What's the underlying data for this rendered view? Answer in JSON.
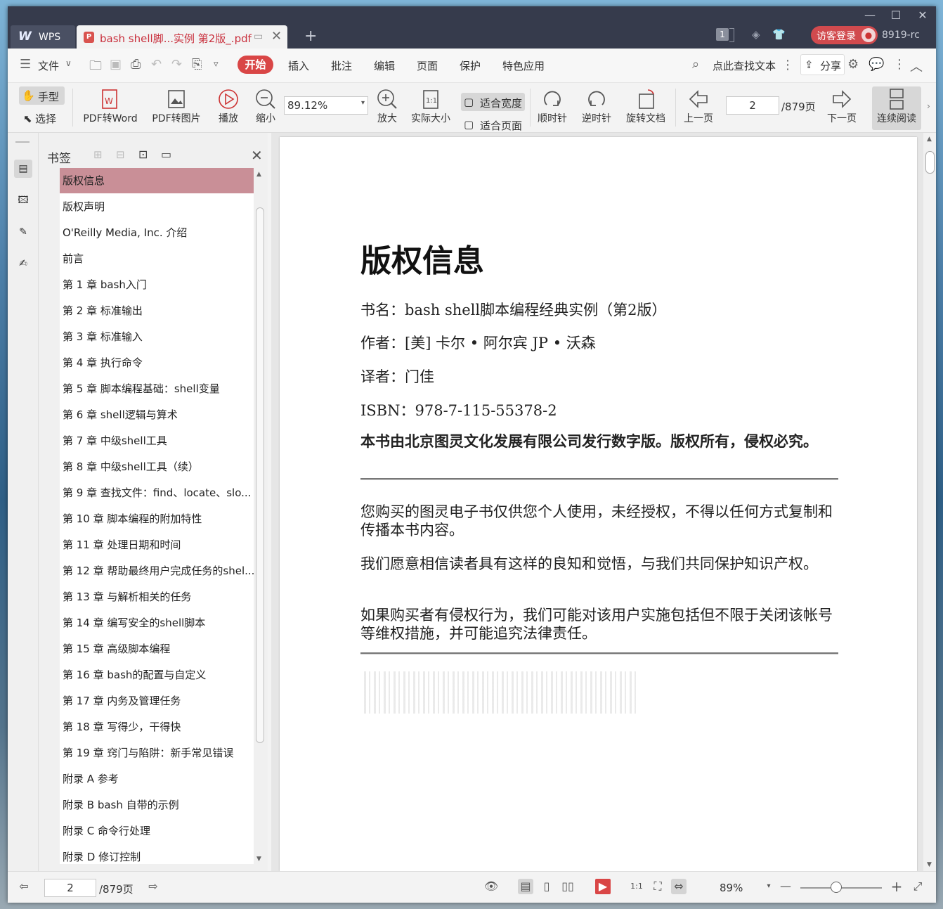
{
  "window": {
    "title_tabs": [
      {
        "label": "WPS"
      },
      {
        "label": "bash shell脚...实例 第2版_.pdf"
      }
    ],
    "version_text": "8919-rc",
    "login_label": "访客登录",
    "page_count_badge": "1"
  },
  "menubar": {
    "file_label": "文件",
    "tabs": [
      "开始",
      "插入",
      "批注",
      "编辑",
      "页面",
      "保护",
      "特色应用"
    ],
    "active_tab": "开始",
    "search_label": "点此查找文本",
    "share_label": "分享"
  },
  "toolbar": {
    "hand_label": "手型",
    "select_label": "选择",
    "pdf_to_word": "PDF转Word",
    "pdf_to_image": "PDF转图片",
    "play": "播放",
    "zoom_out": "缩小",
    "zoom_value": "89.12%",
    "zoom_in": "放大",
    "actual_size": "实际大小",
    "fit_width": "适合宽度",
    "fit_page": "适合页面",
    "rotate_cw": "顺时针",
    "rotate_ccw": "逆时针",
    "rotate_doc": "旋转文档",
    "prev_page": "上一页",
    "page_current": "2",
    "page_total": "/879页",
    "next_page": "下一页",
    "continuous": "连续阅读"
  },
  "bookmarks": {
    "title": "书签",
    "selected_index": 0,
    "items": [
      "版权信息",
      "版权声明",
      "O'Reilly Media, Inc. 介绍",
      "前言",
      "第 1 章 bash入门",
      "第 2 章 标准输出",
      "第 3 章 标准输入",
      "第 4 章 执行命令",
      "第 5 章 脚本编程基础：shell变量",
      "第 6 章 shell逻辑与算术",
      "第 7 章 中级shell工具",
      "第 8 章 中级shell工具（续）",
      "第 9 章 查找文件：find、locate、slo...",
      "第 10 章 脚本编程的附加特性",
      "第 11 章 处理日期和时间",
      "第 12 章 帮助最终用户完成任务的shel...",
      "第 13 章 与解析相关的任务",
      "第 14 章 编写安全的shell脚本",
      "第 15 章 高级脚本编程",
      "第 16 章 bash的配置与自定义",
      "第 17 章 内务及管理任务",
      "第 18 章 写得少，干得快",
      "第 19 章 窍门与陷阱：新手常见错误",
      "附录 A 参考",
      "附录 B bash 自带的示例",
      "附录 C 命令行处理",
      "附录 D 修订控制"
    ]
  },
  "document": {
    "heading": "版权信息",
    "book_name": "书名：bash shell脚本编程经典实例（第2版）",
    "authors": "作者：[美] 卡尔 • 阿尔宾  JP • 沃森",
    "translator": "译者：门佳",
    "isbn": "ISBN：978-7-115-55378-2",
    "publisher_note": "本书由北京图灵文化发展有限公司发行数字版。版权所有，侵权必究。",
    "para1": "您购买的图灵电子书仅供您个人使用，未经授权，不得以任何方式复制和传播本书内容。",
    "para2": "我们愿意相信读者具有这样的良知和觉悟，与我们共同保护知识产权。",
    "para3": "如果购买者有侵权行为，我们可能对该用户实施包括但不限于关闭该帐号等维权措施，并可能追究法律责任。"
  },
  "statusbar": {
    "page_current": "2",
    "page_total": "/879页",
    "zoom_value": "89%"
  },
  "colors": {
    "accent": "#d94646",
    "selected_bookmark": "#c98f97",
    "titlebar": "#363b4c"
  }
}
